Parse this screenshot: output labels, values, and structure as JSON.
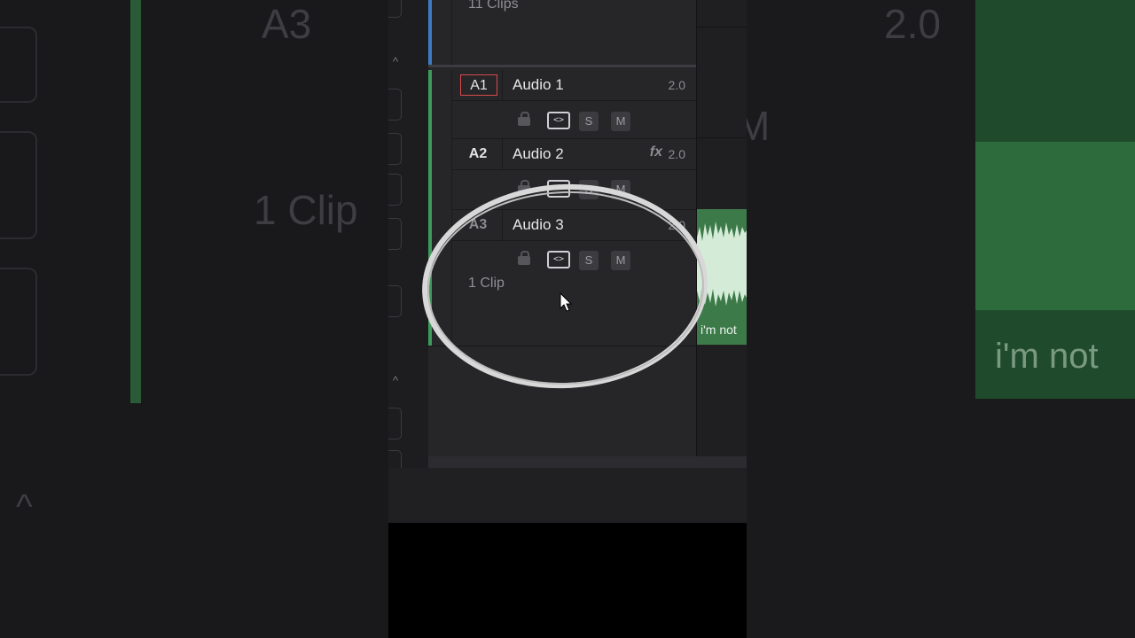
{
  "tracks": [
    {
      "id": "A1",
      "name": "Audio 1",
      "channels": "2.0",
      "fx": "",
      "selected": true,
      "color": "#3d9a5a"
    },
    {
      "id": "A2",
      "name": "Audio 2",
      "channels": "2.0",
      "fx": "fx",
      "selected": false,
      "color": "#3d9a5a"
    },
    {
      "id": "A3",
      "name": "Audio 3",
      "channels": "2.0",
      "fx": "",
      "selected": false,
      "color": "#3d9a5a"
    }
  ],
  "controls": {
    "solo": "S",
    "mute": "M",
    "auto": "<>"
  },
  "clips": {
    "video_count": "11 Clips",
    "a3_count": "1 Clip",
    "clip_caption": "i'm not"
  },
  "background": {
    "big_track_id": "A3",
    "big_channels": "2.0",
    "big_clip_count": "1 Clip",
    "big_caption": "i'm not",
    "big_mute": "M"
  },
  "colors": {
    "video_track": "#3b7cc4",
    "audio_track": "#3d9a5a",
    "select_border": "#d9484a",
    "waveform": "#3d7a4a"
  }
}
